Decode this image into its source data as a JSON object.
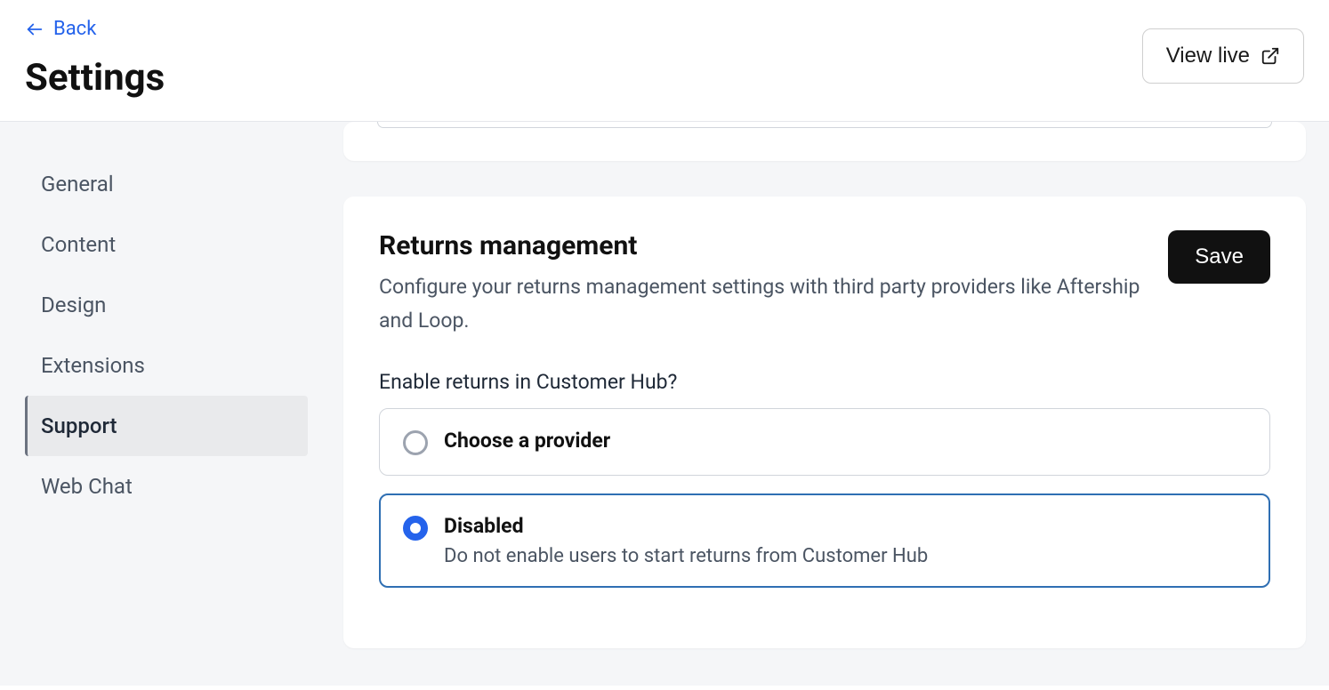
{
  "header": {
    "back_label": "Back",
    "page_title": "Settings",
    "view_live_label": "View live"
  },
  "sidebar": {
    "items": [
      {
        "label": "General",
        "active": false
      },
      {
        "label": "Content",
        "active": false
      },
      {
        "label": "Design",
        "active": false
      },
      {
        "label": "Extensions",
        "active": false
      },
      {
        "label": "Support",
        "active": true
      },
      {
        "label": "Web Chat",
        "active": false
      }
    ]
  },
  "main": {
    "returns": {
      "title": "Returns management",
      "description": "Configure your returns management settings with third party providers like Aftership and Loop.",
      "save_label": "Save",
      "field_label": "Enable returns in Customer Hub?",
      "options": [
        {
          "title": "Choose a provider",
          "description": "",
          "selected": false
        },
        {
          "title": "Disabled",
          "description": "Do not enable users to start returns from Customer Hub",
          "selected": true
        }
      ]
    }
  }
}
